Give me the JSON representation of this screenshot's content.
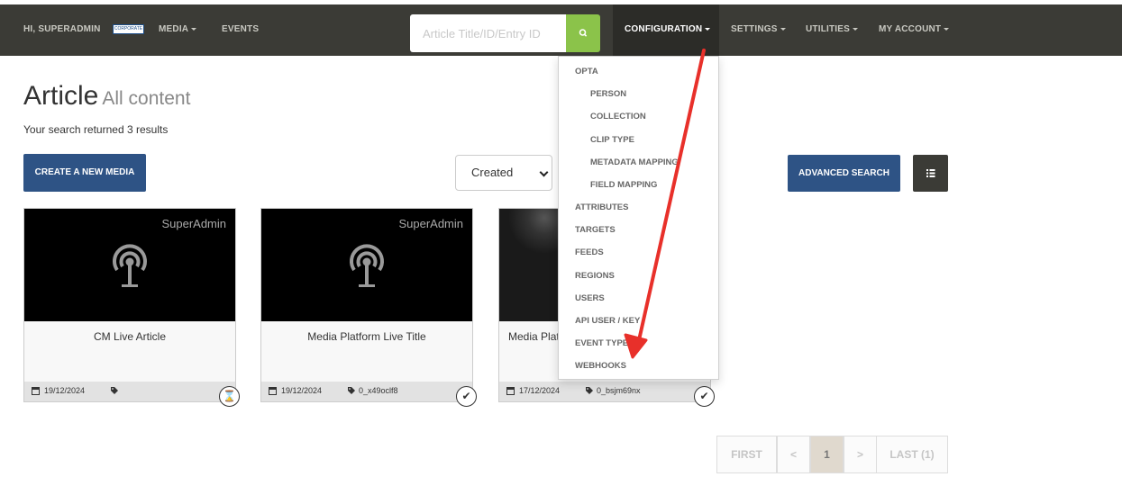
{
  "navbar": {
    "greeting": "HI, SUPERADMIN",
    "logo_text": "CORPORATE",
    "media": "MEDIA",
    "events": "EVENTS",
    "search_placeholder": "Article Title/ID/Entry ID",
    "configuration": "CONFIGURATION",
    "settings": "SETTINGS",
    "utilities": "UTILITIES",
    "my_account": "MY ACCOUNT"
  },
  "page": {
    "title": "Article",
    "subtitle": "All content",
    "results": "Your search returned 3 results",
    "create_button": "CREATE A NEW MEDIA",
    "sort_value": "Created",
    "advanced_search": "ADVANCED SEARCH"
  },
  "cards": [
    {
      "owner": "SuperAdmin",
      "title": "CM Live Article",
      "date": "19/12/2024",
      "entry_id": "",
      "status": "pending"
    },
    {
      "owner": "SuperAdmin",
      "title": "Media Platform Live Title",
      "date": "19/12/2024",
      "entry_id": "0_x49oclf8",
      "status": "ok"
    },
    {
      "owner": "",
      "title": "Media Plat",
      "date": "17/12/2024",
      "entry_id": "0_bsjm69nx",
      "status": "ok"
    }
  ],
  "dropdown": {
    "items": [
      "OPTA",
      "PERSON",
      "COLLECTION",
      "CLIP TYPE",
      "METADATA MAPPING",
      "FIELD MAPPING",
      "ATTRIBUTES",
      "TARGETS",
      "FEEDS",
      "REGIONS",
      "USERS",
      "API USER / KEY",
      "EVENT TYPE",
      "WEBHOOKS"
    ]
  },
  "pagination": {
    "first": "FIRST",
    "prev": "<",
    "current": "1",
    "next": ">",
    "last": "LAST (1)"
  },
  "colors": {
    "navbar": "#3b3b36",
    "primary": "#2e5385",
    "search_button": "#8bc34a",
    "annotation_arrow": "#e8302a"
  }
}
